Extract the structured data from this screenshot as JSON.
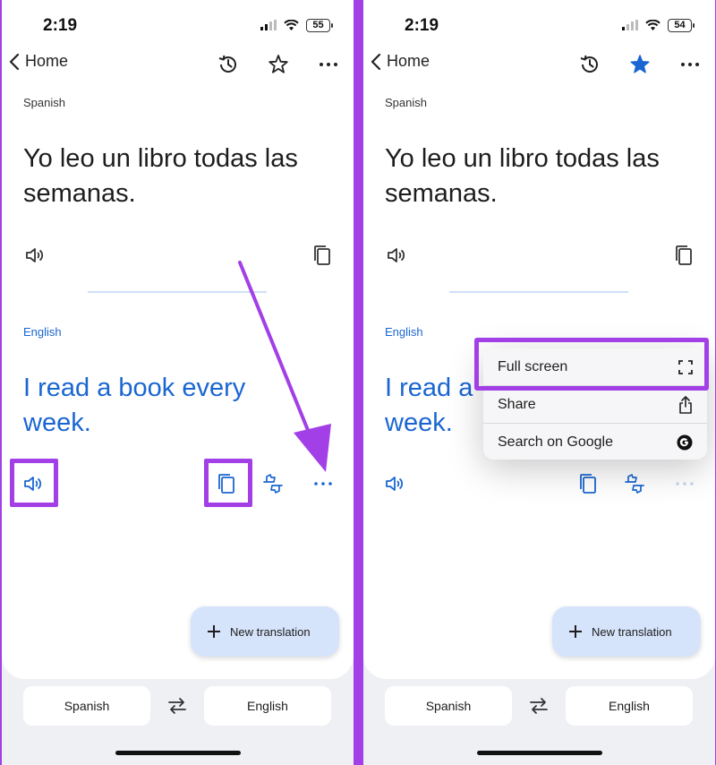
{
  "status": {
    "time": "2:19",
    "battery_left": "55",
    "battery_right": "54"
  },
  "header": {
    "back_label": "Home"
  },
  "translation": {
    "source_lang": "Spanish",
    "source_text": "Yo leo un libro todas las semanas.",
    "target_lang": "English",
    "target_text": "I read a book every week.",
    "target_text_partial": "I read a",
    "target_text_line2": "week."
  },
  "fab": {
    "label": "New translation"
  },
  "language_bar": {
    "source": "Spanish",
    "target": "English"
  },
  "context_menu": {
    "items": [
      {
        "label": "Full screen",
        "icon": "fullscreen-icon"
      },
      {
        "label": "Share",
        "icon": "share-icon"
      },
      {
        "label": "Search on Google",
        "icon": "google-icon"
      }
    ]
  },
  "colors": {
    "accent": "#1a66d1",
    "highlight": "#a23fe6",
    "starred": "#1a66d1",
    "fab_bg": "#d6e4fb"
  }
}
